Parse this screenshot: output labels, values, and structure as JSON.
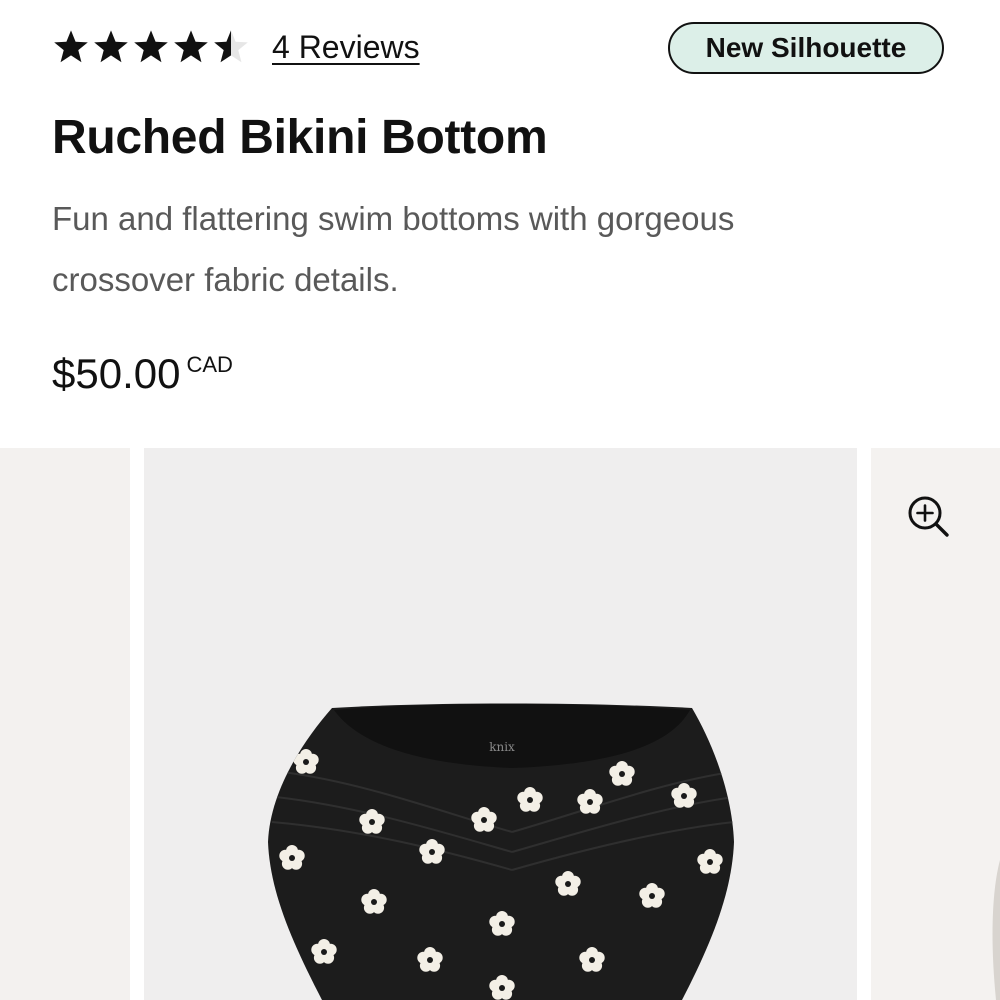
{
  "rating": {
    "value": 4.5,
    "max": 5,
    "reviews_label": "4 Reviews"
  },
  "badge": {
    "label": "New Silhouette",
    "background": "#dcefe8"
  },
  "product": {
    "title": "Ruched Bikini Bottom",
    "description": "Fun and flattering swim bottoms with gorgeous crossover fabric details.",
    "price": "$50.00",
    "currency": "CAD",
    "brand_mark": "knix"
  },
  "gallery": {
    "zoom_icon": "zoom-in-icon",
    "image_icon": "floral-bikini-bottom"
  }
}
